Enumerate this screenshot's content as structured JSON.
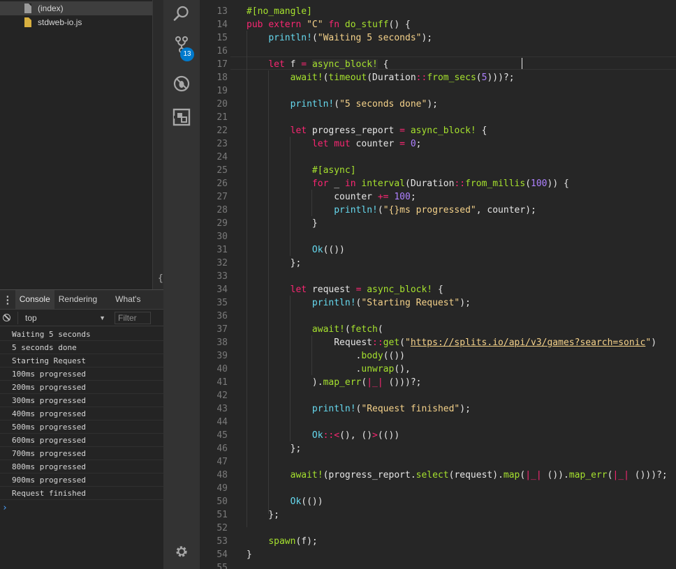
{
  "file_tree": {
    "items": [
      {
        "label": "(index)",
        "icon": "file-icon",
        "selected": true
      },
      {
        "label": "stdweb-io.js",
        "icon": "js-file-icon",
        "selected": false
      }
    ],
    "brace": "{"
  },
  "drawer": {
    "menu_glyph": "⋮",
    "tabs": [
      {
        "label": "Console",
        "active": true
      },
      {
        "label": "Rendering",
        "active": false
      },
      {
        "label": "What's New",
        "active": false
      }
    ]
  },
  "console": {
    "context": "top",
    "caret": "▼",
    "filter_placeholder": "Filter",
    "lines": [
      "Waiting 5 seconds",
      "5 seconds done",
      "Starting Request",
      "100ms progressed",
      "200ms progressed",
      "300ms progressed",
      "400ms progressed",
      "500ms progressed",
      "600ms progressed",
      "700ms progressed",
      "800ms progressed",
      "900ms progressed",
      "Request finished"
    ],
    "prompt": "›"
  },
  "activity_bar": {
    "scm_badge": "13",
    "icons": [
      "search-icon",
      "source-control-icon",
      "debug-icon",
      "extensions-icon",
      "settings-gear-icon"
    ]
  },
  "colors": {
    "accent": "#007acc",
    "string": "#f5d28a",
    "keyword": "#f92672",
    "function": "#66d9ef",
    "macro": "#a6e22e",
    "number": "#ae81ff"
  },
  "editor": {
    "lines": [
      {
        "n": "13",
        "tokens": [
          [
            "attr",
            "#[no_mangle]"
          ]
        ]
      },
      {
        "n": "14",
        "tokens": [
          [
            "kw",
            "pub"
          ],
          [
            "plain",
            " "
          ],
          [
            "kw",
            "extern"
          ],
          [
            "plain",
            " "
          ],
          [
            "str",
            "\"C\""
          ],
          [
            "plain",
            " "
          ],
          [
            "kw",
            "fn"
          ],
          [
            "plain",
            " "
          ],
          [
            "mac",
            "do_stuff"
          ],
          [
            "plain",
            "() {"
          ]
        ]
      },
      {
        "n": "15",
        "tokens": [
          [
            "plain",
            "    "
          ],
          [
            "fn",
            "println!"
          ],
          [
            "plain",
            "("
          ],
          [
            "str",
            "\"Waiting 5 seconds\""
          ],
          [
            "plain",
            ");"
          ]
        ]
      },
      {
        "n": "16",
        "tokens": []
      },
      {
        "n": "17",
        "tokens": [
          [
            "plain",
            "    "
          ],
          [
            "kw",
            "let"
          ],
          [
            "plain",
            " f "
          ],
          [
            "kw",
            "="
          ],
          [
            "plain",
            " "
          ],
          [
            "mhl",
            "async_block!"
          ],
          [
            "plain",
            " {"
          ]
        ]
      },
      {
        "n": "18",
        "tokens": [
          [
            "plain",
            "        "
          ],
          [
            "mac",
            "await!"
          ],
          [
            "plain",
            "("
          ],
          [
            "mac",
            "timeout"
          ],
          [
            "plain",
            "(Duration"
          ],
          [
            "kw",
            "::"
          ],
          [
            "mac",
            "from_secs"
          ],
          [
            "plain",
            "("
          ],
          [
            "num",
            "5"
          ],
          [
            "plain",
            ")))?;"
          ]
        ]
      },
      {
        "n": "19",
        "tokens": []
      },
      {
        "n": "20",
        "tokens": [
          [
            "plain",
            "        "
          ],
          [
            "fn",
            "println!"
          ],
          [
            "plain",
            "("
          ],
          [
            "str",
            "\"5 seconds done\""
          ],
          [
            "plain",
            ");"
          ]
        ]
      },
      {
        "n": "21",
        "tokens": []
      },
      {
        "n": "22",
        "tokens": [
          [
            "plain",
            "        "
          ],
          [
            "kw",
            "let"
          ],
          [
            "plain",
            " progress_report "
          ],
          [
            "kw",
            "="
          ],
          [
            "plain",
            " "
          ],
          [
            "mac",
            "async_block!"
          ],
          [
            "plain",
            " {"
          ]
        ]
      },
      {
        "n": "23",
        "tokens": [
          [
            "plain",
            "            "
          ],
          [
            "kw",
            "let"
          ],
          [
            "plain",
            " "
          ],
          [
            "kw",
            "mut"
          ],
          [
            "plain",
            " counter "
          ],
          [
            "kw",
            "="
          ],
          [
            "plain",
            " "
          ],
          [
            "num",
            "0"
          ],
          [
            "plain",
            ";"
          ]
        ]
      },
      {
        "n": "24",
        "tokens": []
      },
      {
        "n": "25",
        "tokens": [
          [
            "plain",
            "            "
          ],
          [
            "attr",
            "#[async]"
          ]
        ]
      },
      {
        "n": "26",
        "tokens": [
          [
            "plain",
            "            "
          ],
          [
            "kw",
            "for"
          ],
          [
            "plain",
            " _ "
          ],
          [
            "kw",
            "in"
          ],
          [
            "plain",
            " "
          ],
          [
            "mac",
            "interval"
          ],
          [
            "plain",
            "(Duration"
          ],
          [
            "kw",
            "::"
          ],
          [
            "mac",
            "from_millis"
          ],
          [
            "plain",
            "("
          ],
          [
            "num",
            "100"
          ],
          [
            "plain",
            ")) {"
          ]
        ]
      },
      {
        "n": "27",
        "tokens": [
          [
            "plain",
            "                counter "
          ],
          [
            "kw",
            "+="
          ],
          [
            "plain",
            " "
          ],
          [
            "num",
            "100"
          ],
          [
            "plain",
            ";"
          ]
        ]
      },
      {
        "n": "28",
        "tokens": [
          [
            "plain",
            "                "
          ],
          [
            "fn",
            "println!"
          ],
          [
            "plain",
            "("
          ],
          [
            "str",
            "\"{}ms progressed\""
          ],
          [
            "plain",
            ", counter);"
          ]
        ]
      },
      {
        "n": "29",
        "tokens": [
          [
            "plain",
            "            }"
          ]
        ]
      },
      {
        "n": "30",
        "tokens": []
      },
      {
        "n": "31",
        "tokens": [
          [
            "plain",
            "            "
          ],
          [
            "fn",
            "Ok"
          ],
          [
            "plain",
            "(())"
          ]
        ]
      },
      {
        "n": "32",
        "tokens": [
          [
            "plain",
            "        };"
          ]
        ]
      },
      {
        "n": "33",
        "tokens": []
      },
      {
        "n": "34",
        "tokens": [
          [
            "plain",
            "        "
          ],
          [
            "kw",
            "let"
          ],
          [
            "plain",
            " request "
          ],
          [
            "kw",
            "="
          ],
          [
            "plain",
            " "
          ],
          [
            "mac",
            "async_block!"
          ],
          [
            "plain",
            " {"
          ]
        ]
      },
      {
        "n": "35",
        "tokens": [
          [
            "plain",
            "            "
          ],
          [
            "fn",
            "println!"
          ],
          [
            "plain",
            "("
          ],
          [
            "str",
            "\"Starting Request\""
          ],
          [
            "plain",
            ");"
          ]
        ]
      },
      {
        "n": "36",
        "tokens": []
      },
      {
        "n": "37",
        "tokens": [
          [
            "plain",
            "            "
          ],
          [
            "mac",
            "await!"
          ],
          [
            "plain",
            "("
          ],
          [
            "mac",
            "fetch"
          ],
          [
            "plain",
            "("
          ]
        ]
      },
      {
        "n": "38",
        "tokens": [
          [
            "plain",
            "                Request"
          ],
          [
            "kw",
            "::"
          ],
          [
            "mac",
            "get"
          ],
          [
            "plain",
            "("
          ],
          [
            "str",
            "\""
          ],
          [
            "link",
            "https://splits.io/api/v3/games?search=sonic"
          ],
          [
            "str",
            "\""
          ],
          [
            "plain",
            ")"
          ]
        ]
      },
      {
        "n": "39",
        "tokens": [
          [
            "plain",
            "                    ."
          ],
          [
            "mac",
            "body"
          ],
          [
            "plain",
            "(())"
          ]
        ]
      },
      {
        "n": "40",
        "tokens": [
          [
            "plain",
            "                    ."
          ],
          [
            "mac",
            "unwrap"
          ],
          [
            "plain",
            "(),"
          ]
        ]
      },
      {
        "n": "41",
        "tokens": [
          [
            "plain",
            "            )."
          ],
          [
            "mac",
            "map_err"
          ],
          [
            "plain",
            "("
          ],
          [
            "kw",
            "|_|"
          ],
          [
            "plain",
            " ()))?;"
          ]
        ]
      },
      {
        "n": "42",
        "tokens": []
      },
      {
        "n": "43",
        "tokens": [
          [
            "plain",
            "            "
          ],
          [
            "fn",
            "println!"
          ],
          [
            "plain",
            "("
          ],
          [
            "str",
            "\"Request finished\""
          ],
          [
            "plain",
            ");"
          ]
        ]
      },
      {
        "n": "44",
        "tokens": []
      },
      {
        "n": "45",
        "tokens": [
          [
            "plain",
            "            "
          ],
          [
            "fn",
            "Ok"
          ],
          [
            "kw",
            "::<"
          ],
          [
            "plain",
            "(), ()"
          ],
          [
            "kw",
            ">"
          ],
          [
            "plain",
            "(())"
          ]
        ]
      },
      {
        "n": "46",
        "tokens": [
          [
            "plain",
            "        };"
          ]
        ]
      },
      {
        "n": "47",
        "tokens": []
      },
      {
        "n": "48",
        "tokens": [
          [
            "plain",
            "        "
          ],
          [
            "mac",
            "await!"
          ],
          [
            "plain",
            "(progress_report."
          ],
          [
            "mac",
            "select"
          ],
          [
            "plain",
            "(request)."
          ],
          [
            "mac",
            "map"
          ],
          [
            "plain",
            "("
          ],
          [
            "kw",
            "|_|"
          ],
          [
            "plain",
            " ())."
          ],
          [
            "mac",
            "map_err"
          ],
          [
            "plain",
            "("
          ],
          [
            "kw",
            "|_|"
          ],
          [
            "plain",
            " ()))?;"
          ]
        ]
      },
      {
        "n": "49",
        "tokens": []
      },
      {
        "n": "50",
        "tokens": [
          [
            "plain",
            "        "
          ],
          [
            "fn",
            "Ok"
          ],
          [
            "plain",
            "(())"
          ]
        ]
      },
      {
        "n": "51",
        "tokens": [
          [
            "plain",
            "    };"
          ]
        ]
      },
      {
        "n": "52",
        "tokens": []
      },
      {
        "n": "53",
        "tokens": [
          [
            "plain",
            "    "
          ],
          [
            "mac",
            "spawn"
          ],
          [
            "plain",
            "(f);"
          ]
        ]
      },
      {
        "n": "54",
        "tokens": [
          [
            "plain",
            "}"
          ]
        ]
      },
      {
        "n": "55",
        "tokens": []
      }
    ]
  }
}
